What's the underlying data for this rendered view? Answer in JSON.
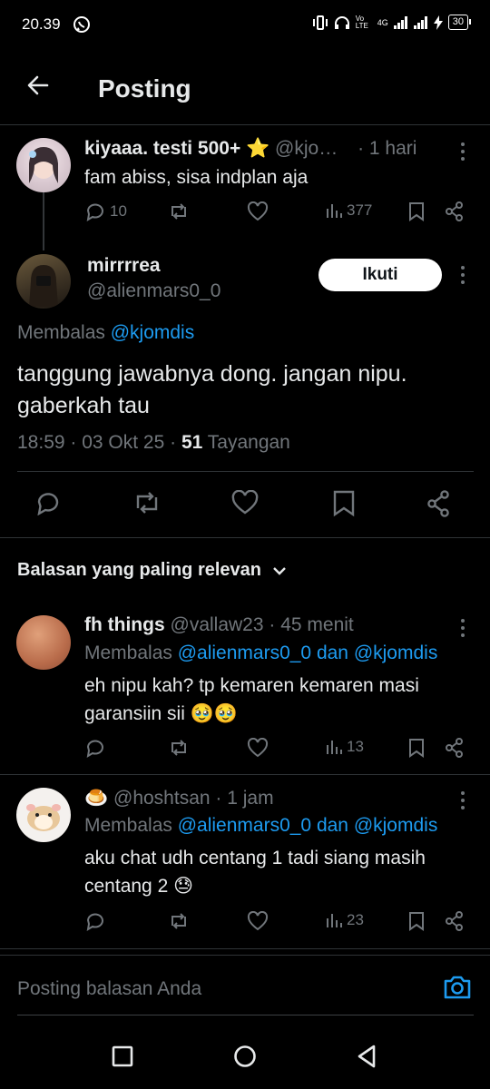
{
  "status_bar": {
    "time": "20.39",
    "network_labels": [
      "Vo LTE",
      "4G"
    ],
    "battery": "30"
  },
  "header": {
    "title": "Posting"
  },
  "parent_post": {
    "name": "kiyaaa. testi 500+ ⭐",
    "handle": "@kjo…",
    "time": "· 1 hari",
    "text": "fam abiss, sisa indplan aja",
    "replies": "10",
    "views": "377"
  },
  "main_post": {
    "name": "mirrrrea",
    "handle": "@alienmars0_0",
    "follow_label": "Ikuti",
    "replying_prefix": "Membalas",
    "replying_to": "@kjomdis",
    "text_line1": "tanggung jawabnya dong. jangan nipu.",
    "text_line2": "gaberkah tau",
    "timestamp": "18:59 · 03 Okt 25 ·",
    "views_count": "51",
    "views_label": "Tayangan"
  },
  "sort": {
    "label": "Balasan yang paling relevan"
  },
  "replies": [
    {
      "name": "fh things",
      "handle": "@vallaw23",
      "time": "· 45 menit",
      "replying_prefix": "Membalas",
      "replying_to": "@alienmars0_0 dan @kjomdis",
      "text_line1": "eh nipu kah? tp kemaren kemaren masi",
      "text_line2": "garansiin sii 🥹🥹",
      "views": "13"
    },
    {
      "name": "🍮",
      "handle": "@hoshtsan",
      "time": "· 1 jam",
      "replying_prefix": "Membalas",
      "replying_to": "@alienmars0_0 dan @kjomdis",
      "text_line1": "aku chat udh centang 1 tadi siang masih",
      "text_line2": "centang 2 😓",
      "views": "23"
    }
  ],
  "composer": {
    "placeholder": "Posting balasan Anda"
  },
  "colors": {
    "accent": "#1d9bf0",
    "muted": "#71767b",
    "background": "#000000",
    "text": "#e7e9ea"
  }
}
